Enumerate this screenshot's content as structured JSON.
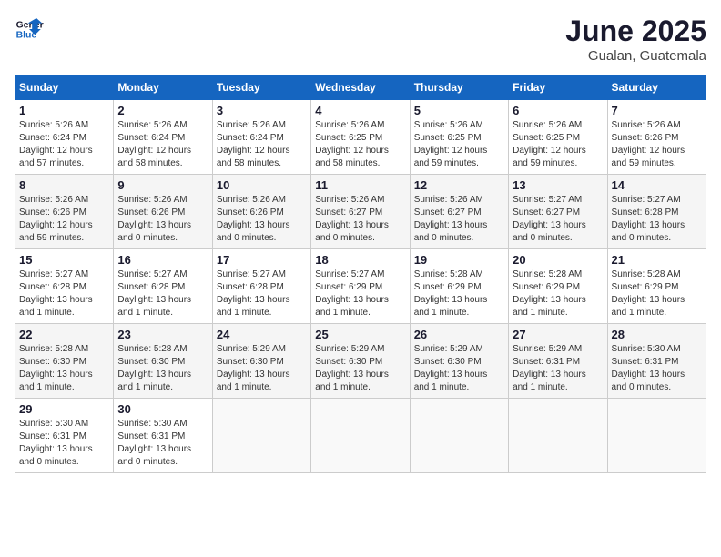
{
  "header": {
    "logo_general": "General",
    "logo_blue": "Blue",
    "month_title": "June 2025",
    "subtitle": "Gualan, Guatemala"
  },
  "weekdays": [
    "Sunday",
    "Monday",
    "Tuesday",
    "Wednesday",
    "Thursday",
    "Friday",
    "Saturday"
  ],
  "weeks": [
    [
      {
        "day": "1",
        "sunrise": "5:26 AM",
        "sunset": "6:24 PM",
        "daylight": "12 hours and 57 minutes."
      },
      {
        "day": "2",
        "sunrise": "5:26 AM",
        "sunset": "6:24 PM",
        "daylight": "12 hours and 58 minutes."
      },
      {
        "day": "3",
        "sunrise": "5:26 AM",
        "sunset": "6:24 PM",
        "daylight": "12 hours and 58 minutes."
      },
      {
        "day": "4",
        "sunrise": "5:26 AM",
        "sunset": "6:25 PM",
        "daylight": "12 hours and 58 minutes."
      },
      {
        "day": "5",
        "sunrise": "5:26 AM",
        "sunset": "6:25 PM",
        "daylight": "12 hours and 59 minutes."
      },
      {
        "day": "6",
        "sunrise": "5:26 AM",
        "sunset": "6:25 PM",
        "daylight": "12 hours and 59 minutes."
      },
      {
        "day": "7",
        "sunrise": "5:26 AM",
        "sunset": "6:26 PM",
        "daylight": "12 hours and 59 minutes."
      }
    ],
    [
      {
        "day": "8",
        "sunrise": "5:26 AM",
        "sunset": "6:26 PM",
        "daylight": "12 hours and 59 minutes."
      },
      {
        "day": "9",
        "sunrise": "5:26 AM",
        "sunset": "6:26 PM",
        "daylight": "13 hours and 0 minutes."
      },
      {
        "day": "10",
        "sunrise": "5:26 AM",
        "sunset": "6:26 PM",
        "daylight": "13 hours and 0 minutes."
      },
      {
        "day": "11",
        "sunrise": "5:26 AM",
        "sunset": "6:27 PM",
        "daylight": "13 hours and 0 minutes."
      },
      {
        "day": "12",
        "sunrise": "5:26 AM",
        "sunset": "6:27 PM",
        "daylight": "13 hours and 0 minutes."
      },
      {
        "day": "13",
        "sunrise": "5:27 AM",
        "sunset": "6:27 PM",
        "daylight": "13 hours and 0 minutes."
      },
      {
        "day": "14",
        "sunrise": "5:27 AM",
        "sunset": "6:28 PM",
        "daylight": "13 hours and 0 minutes."
      }
    ],
    [
      {
        "day": "15",
        "sunrise": "5:27 AM",
        "sunset": "6:28 PM",
        "daylight": "13 hours and 1 minute."
      },
      {
        "day": "16",
        "sunrise": "5:27 AM",
        "sunset": "6:28 PM",
        "daylight": "13 hours and 1 minute."
      },
      {
        "day": "17",
        "sunrise": "5:27 AM",
        "sunset": "6:28 PM",
        "daylight": "13 hours and 1 minute."
      },
      {
        "day": "18",
        "sunrise": "5:27 AM",
        "sunset": "6:29 PM",
        "daylight": "13 hours and 1 minute."
      },
      {
        "day": "19",
        "sunrise": "5:28 AM",
        "sunset": "6:29 PM",
        "daylight": "13 hours and 1 minute."
      },
      {
        "day": "20",
        "sunrise": "5:28 AM",
        "sunset": "6:29 PM",
        "daylight": "13 hours and 1 minute."
      },
      {
        "day": "21",
        "sunrise": "5:28 AM",
        "sunset": "6:29 PM",
        "daylight": "13 hours and 1 minute."
      }
    ],
    [
      {
        "day": "22",
        "sunrise": "5:28 AM",
        "sunset": "6:30 PM",
        "daylight": "13 hours and 1 minute."
      },
      {
        "day": "23",
        "sunrise": "5:28 AM",
        "sunset": "6:30 PM",
        "daylight": "13 hours and 1 minute."
      },
      {
        "day": "24",
        "sunrise": "5:29 AM",
        "sunset": "6:30 PM",
        "daylight": "13 hours and 1 minute."
      },
      {
        "day": "25",
        "sunrise": "5:29 AM",
        "sunset": "6:30 PM",
        "daylight": "13 hours and 1 minute."
      },
      {
        "day": "26",
        "sunrise": "5:29 AM",
        "sunset": "6:30 PM",
        "daylight": "13 hours and 1 minute."
      },
      {
        "day": "27",
        "sunrise": "5:29 AM",
        "sunset": "6:31 PM",
        "daylight": "13 hours and 1 minute."
      },
      {
        "day": "28",
        "sunrise": "5:30 AM",
        "sunset": "6:31 PM",
        "daylight": "13 hours and 0 minutes."
      }
    ],
    [
      {
        "day": "29",
        "sunrise": "5:30 AM",
        "sunset": "6:31 PM",
        "daylight": "13 hours and 0 minutes."
      },
      {
        "day": "30",
        "sunrise": "5:30 AM",
        "sunset": "6:31 PM",
        "daylight": "13 hours and 0 minutes."
      },
      null,
      null,
      null,
      null,
      null
    ]
  ]
}
